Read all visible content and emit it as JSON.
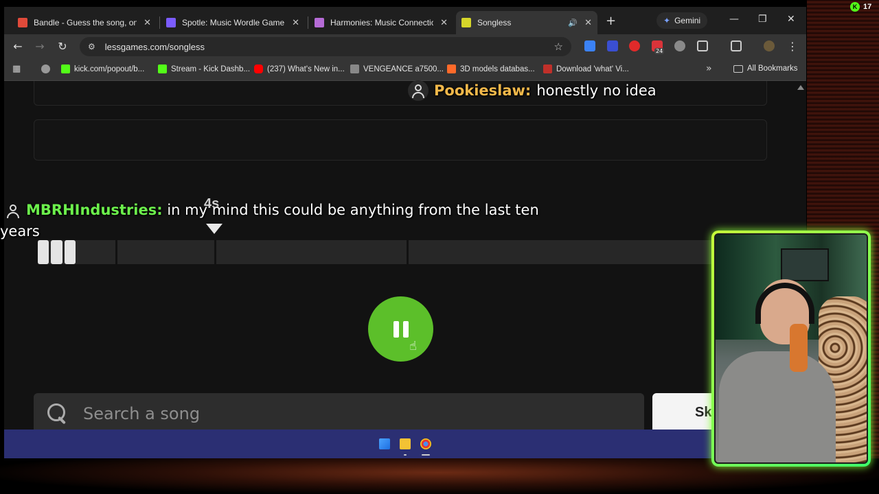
{
  "browser": {
    "tabs": [
      {
        "label": "Bandle - Guess the song, one in",
        "color": "#e04a3a"
      },
      {
        "label": "Spotle: Music Wordle Game",
        "color": "#7b5cff"
      },
      {
        "label": "Harmonies: Music Connections",
        "color": "#b56bd6"
      },
      {
        "label": "Songless",
        "color": "#d6d62a"
      }
    ],
    "gemini_label": "Gemini",
    "url": "lessgames.com/songless",
    "bookmarks": [
      {
        "label": "kick.com/popout/b...",
        "color": "#53fc18"
      },
      {
        "label": "Stream - Kick Dashb...",
        "color": "#53fc18"
      },
      {
        "label": "(237) What's New in...",
        "color": "#ff0000"
      },
      {
        "label": "VENGEANCE a7500...",
        "color": "#888888"
      },
      {
        "label": "3D models databas...",
        "color": "#ff6a2a"
      },
      {
        "label": "Download 'what' Vi...",
        "color": "#c0302a"
      }
    ],
    "all_bookmarks_label": "All Bookmarks",
    "extension_badge": "24"
  },
  "game": {
    "time_marker": "4s",
    "progress": 0.055,
    "search_placeholder": "Search a song",
    "skip_label": "Sk"
  },
  "chat": [
    {
      "user": "Pookieslaw:",
      "message": "honestly no idea",
      "color": "#f2b84a"
    },
    {
      "user": "MBRHIndustries:",
      "message": "in my mind this could be anything from the last ten years",
      "color": "#6cf04c"
    }
  ],
  "overlay": {
    "viewer_count": "17"
  }
}
